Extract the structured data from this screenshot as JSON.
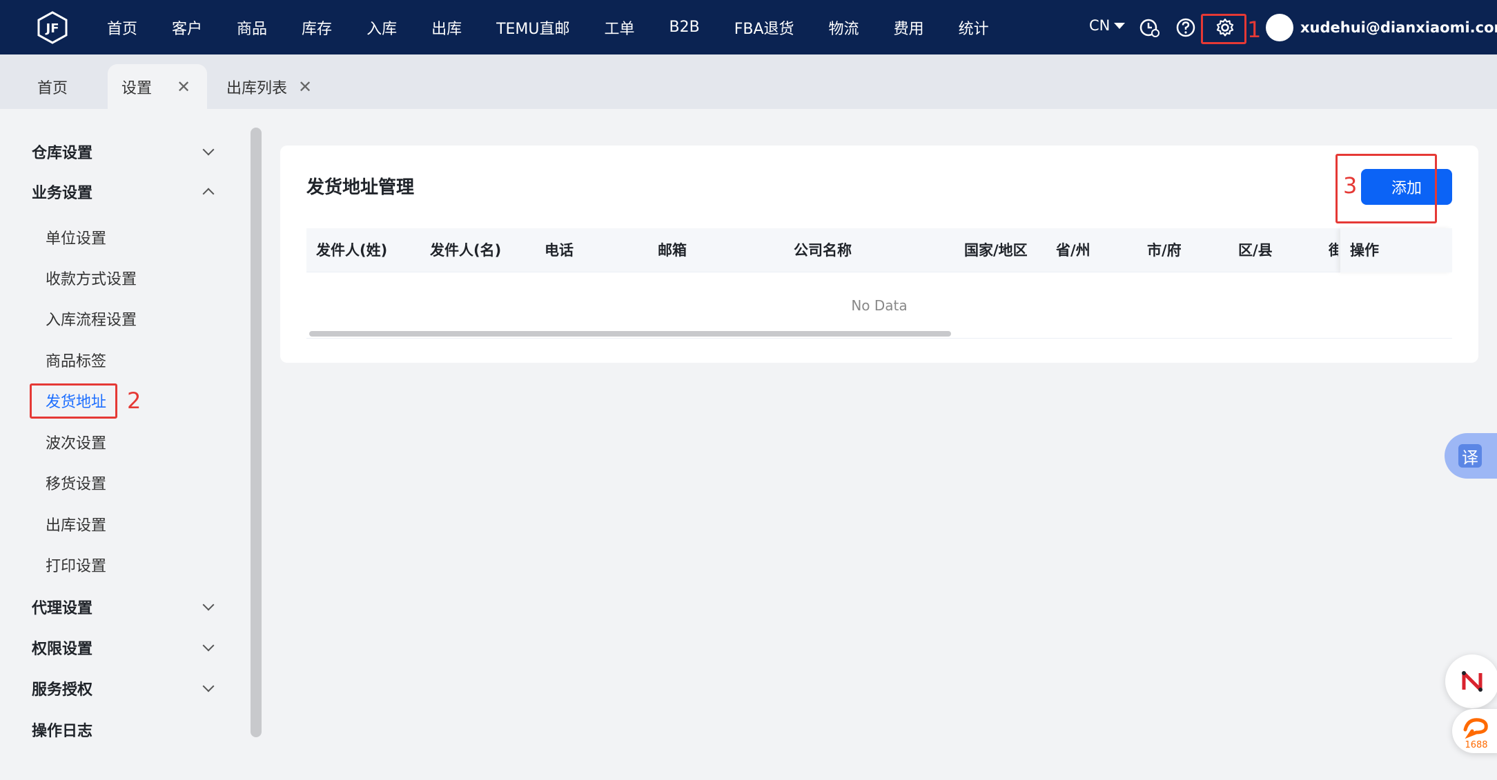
{
  "nav": {
    "items": [
      "首页",
      "客户",
      "商品",
      "库存",
      "入库",
      "出库",
      "TEMU直邮",
      "工单",
      "B2B",
      "FBA退货",
      "物流",
      "费用",
      "统计"
    ],
    "lang": "CN",
    "user_email": "xudehui@dianxiaomi.com"
  },
  "tabs": {
    "home": "首页",
    "settings": "设置",
    "outbound_list": "出库列表",
    "close": "✕"
  },
  "sidebar": {
    "warehouse_settings": "仓库设置",
    "business_settings": "业务设置",
    "sub_items": [
      "单位设置",
      "收款方式设置",
      "入库流程设置",
      "商品标签",
      "发货地址",
      "波次设置",
      "移货设置",
      "出库设置",
      "打印设置"
    ],
    "agent_settings": "代理设置",
    "permission_settings": "权限设置",
    "service_auth": "服务授权",
    "operation_log": "操作日志"
  },
  "main": {
    "title": "发货地址管理",
    "add_button": "添加",
    "columns": [
      "发件人(姓)",
      "发件人(名)",
      "电话",
      "邮箱",
      "公司名称",
      "国家/地区",
      "省/州",
      "市/府",
      "区/县",
      "街"
    ],
    "op_column": "操作",
    "empty_text": "No Data"
  },
  "annotations": {
    "step1": "1",
    "step2": "2",
    "step3": "3"
  },
  "widgets": {
    "translate": "译",
    "badge_1688": "1688"
  },
  "colors": {
    "topbar": "#0b2352",
    "primary": "#0b63f6",
    "annotation_red": "#e53935"
  }
}
